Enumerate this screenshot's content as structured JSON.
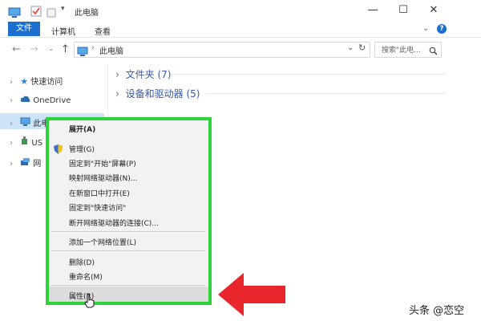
{
  "window": {
    "title": "此电脑",
    "controls": {
      "minimize": "—",
      "maximize": "☐",
      "close": "✕"
    }
  },
  "ribbon": {
    "file_tab": "文件",
    "tabs": [
      "计算机",
      "查看"
    ]
  },
  "address": {
    "path": "此电脑",
    "search_placeholder": "搜索\"此电..."
  },
  "nav_pane": {
    "items": [
      {
        "label": "快速访问",
        "icon": "star-icon"
      },
      {
        "label": "OneDrive",
        "icon": "cloud-icon"
      },
      {
        "label": "此电",
        "icon": "computer-icon"
      },
      {
        "label": "US",
        "icon": "usb-icon"
      },
      {
        "label": "网",
        "icon": "network-icon"
      }
    ]
  },
  "content": {
    "groups": [
      {
        "label": "文件夹 (7)"
      },
      {
        "label": "设备和驱动器 (5)"
      }
    ]
  },
  "context_menu": {
    "items": [
      {
        "label": "展开(A)",
        "bold": true
      },
      {
        "label": "管理(G)",
        "icon": "shield-icon"
      },
      {
        "label": "固定到\"开始\"屏幕(P)"
      },
      {
        "label": "映射网络驱动器(N)..."
      },
      {
        "label": "在新窗口中打开(E)"
      },
      {
        "label": "固定到\"快速访问\""
      },
      {
        "label": "断开网络驱动器的连接(C)..."
      },
      {
        "label": "添加一个网络位置(L)"
      },
      {
        "label": "删除(D)"
      },
      {
        "label": "重命名(M)"
      },
      {
        "label": "属性(R)",
        "hovered": true
      }
    ]
  },
  "colors": {
    "highlight_border": "#2fd23a",
    "arrow": "#e8262c",
    "file_tab": "#1a6fd0"
  },
  "watermark": "头条 @恋空"
}
